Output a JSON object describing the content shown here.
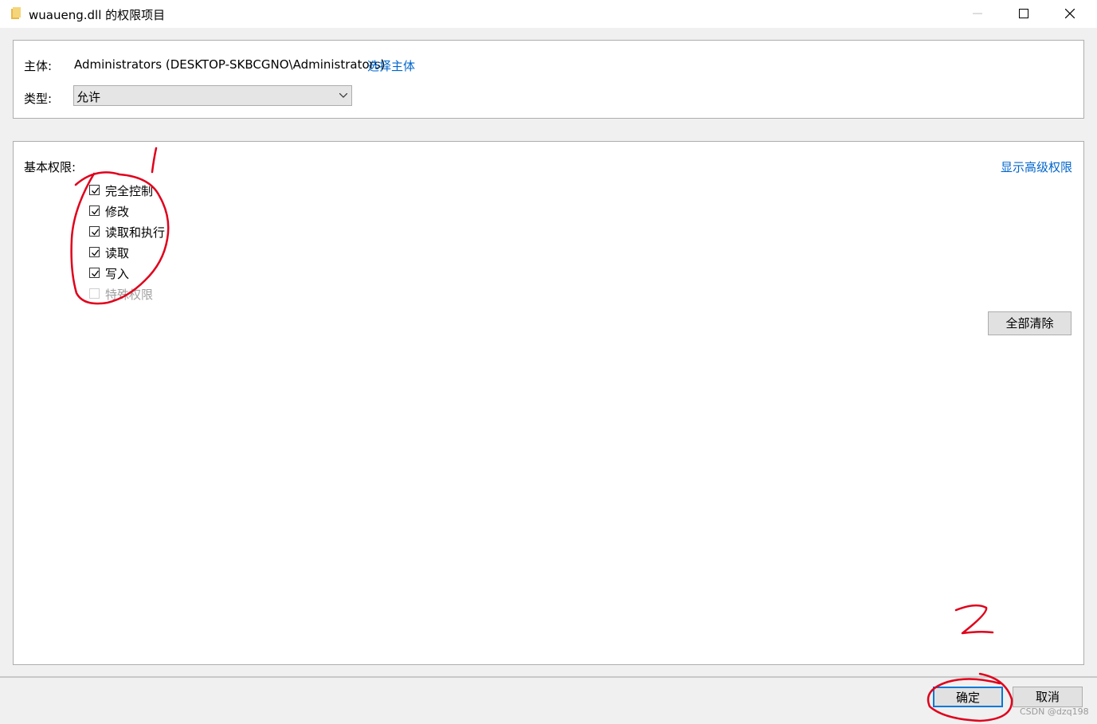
{
  "window": {
    "title": "wuaueng.dll 的权限项目"
  },
  "principal": {
    "label": "主体:",
    "value": "Administrators (DESKTOP-SKBCGNO\\Administrators)",
    "select_link": "选择主体"
  },
  "type": {
    "label": "类型:",
    "value": "允许"
  },
  "permissions": {
    "heading": "基本权限:",
    "advanced_link": "显示高级权限",
    "items": [
      {
        "label": "完全控制",
        "checked": true,
        "enabled": true
      },
      {
        "label": "修改",
        "checked": true,
        "enabled": true
      },
      {
        "label": "读取和执行",
        "checked": true,
        "enabled": true
      },
      {
        "label": "读取",
        "checked": true,
        "enabled": true
      },
      {
        "label": "写入",
        "checked": true,
        "enabled": true
      },
      {
        "label": "特殊权限",
        "checked": false,
        "enabled": false
      }
    ],
    "clear_all_button": "全部清除"
  },
  "footer": {
    "ok_button": "确定",
    "cancel_button": "取消",
    "watermark": "CSDN @dzq198"
  },
  "annotations": {
    "marker_1": "1",
    "marker_2": "2",
    "color": "#e0001b"
  },
  "colors": {
    "link": "#0066cc",
    "focus_border": "#0078d7"
  }
}
